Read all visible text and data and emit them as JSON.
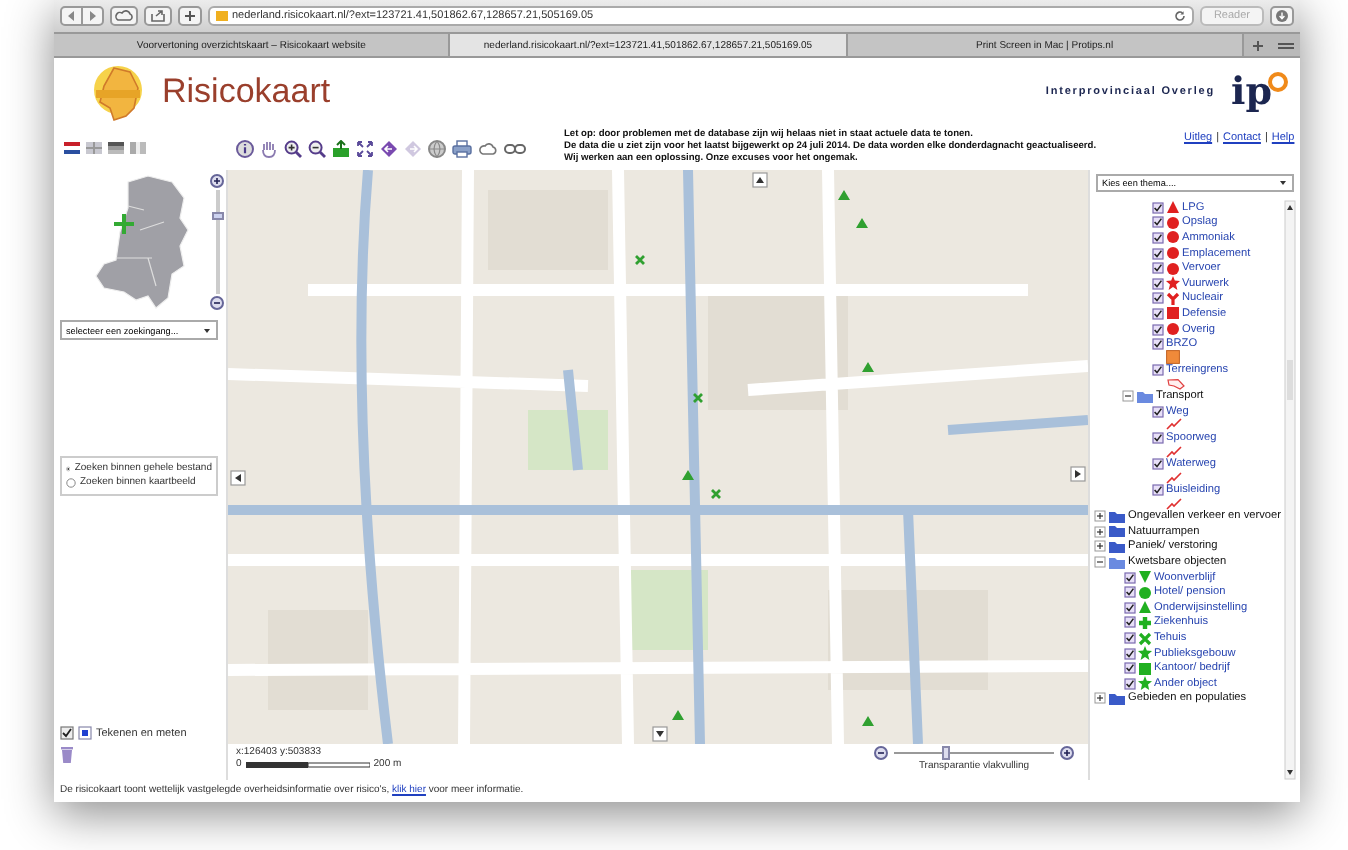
{
  "browser": {
    "address": "nederland.risicokaart.nl/?ext=123721.41,501862.67,128657.21,505169.05",
    "reader_button": "Reader",
    "tabs": [
      {
        "label": "Voorvertoning overzichtskaart – Risicokaart website",
        "selected": false
      },
      {
        "label": "nederland.risicokaart.nl/?ext=123721.41,501862.67,128657.21,505169.05",
        "selected": true
      },
      {
        "label": "Print Screen in Mac | Protips.nl",
        "selected": false
      }
    ]
  },
  "header": {
    "title": "Risicokaart",
    "partner": "Interprovinciaal Overleg",
    "partner_logo": "ip"
  },
  "notice": [
    "Let op: door problemen met de database zijn wij helaas niet in staat actuele data te tonen.",
    "De data die u ziet zijn voor het laatst bijgewerkt op 24 juli 2014. De data worden elke donderdagnacht geactualiseerd.",
    "Wij werken aan een oplossing. Onze excuses voor het ongemak."
  ],
  "links": [
    {
      "kind": "link",
      "text": "Uitleg"
    },
    {
      "kind": "separator",
      "text": "|"
    },
    {
      "kind": "link",
      "text": "Contact"
    },
    {
      "kind": "separator",
      "text": "|"
    },
    {
      "kind": "link",
      "text": "Help"
    }
  ],
  "zoom_slider": {
    "level": 0.78
  },
  "search": {
    "value": "selecteer  een zoekingang...",
    "scope_options": [
      {
        "label": "Zoeken binnen gehele bestand",
        "selected": true
      },
      {
        "label": "Zoeken binnen kaartbeeld",
        "selected": false
      }
    ]
  },
  "draw_tool": {
    "label": "Tekenen en meten",
    "checked": true
  },
  "theme_select": {
    "value": "Kies een thema...."
  },
  "layers": [
    {
      "kind": "continued",
      "children": [
        {
          "kind": "continued",
          "children": [
            {
              "kind": "triangle",
              "label": "LPG",
              "checked": true,
              "color": "#e02020"
            },
            {
              "kind": "circle",
              "label": "Opslag",
              "checked": true,
              "color": "#e02020"
            },
            {
              "kind": "circle",
              "label": "Ammoniak",
              "checked": true,
              "color": "#e02020"
            },
            {
              "kind": "circle",
              "label": "Emplacement",
              "checked": true,
              "color": "#e02020"
            },
            {
              "kind": "circle",
              "label": "Vervoer",
              "checked": true,
              "color": "#e02020"
            },
            {
              "kind": "burst",
              "label": "Vuurwerk",
              "checked": true,
              "color": "#e02020"
            },
            {
              "kind": "trefoil",
              "label": "Nucleair",
              "checked": true,
              "color": "#e02020"
            },
            {
              "kind": "square",
              "label": "Defensie",
              "checked": true,
              "color": "#e02020"
            },
            {
              "kind": "circle",
              "label": "Overig",
              "checked": true,
              "color": "#e02020"
            },
            {
              "kind": "swatch",
              "label": "BRZO",
              "checked": true
            },
            {
              "kind": "outline",
              "label": "Terreingrens",
              "checked": true
            }
          ]
        },
        {
          "kind": "folder",
          "label": "Transport",
          "expanded": true,
          "children": [
            {
              "kind": "line",
              "label": "Weg",
              "checked": true
            },
            {
              "kind": "line",
              "label": "Spoorweg",
              "checked": true
            },
            {
              "kind": "line",
              "label": "Waterweg",
              "checked": true
            },
            {
              "kind": "line",
              "label": "Buisleiding",
              "checked": true
            }
          ]
        }
      ]
    },
    {
      "kind": "folder",
      "label": "Ongevallen verkeer en vervoer",
      "expanded": false
    },
    {
      "kind": "folder",
      "label": "Natuurrampen",
      "expanded": false
    },
    {
      "kind": "folder",
      "label": "Paniek/ verstoring",
      "expanded": false
    },
    {
      "kind": "folder",
      "label": "Kwetsbare objecten",
      "expanded": true,
      "children": [
        {
          "kind": "down-triangle",
          "label": "Woonverblijf",
          "checked": true,
          "color": "#20b020"
        },
        {
          "kind": "circle",
          "label": "Hotel/ pension",
          "checked": true,
          "color": "#20b020"
        },
        {
          "kind": "triangle",
          "label": "Onderwijsinstelling",
          "checked": true,
          "color": "#20b020"
        },
        {
          "kind": "cross",
          "label": "Ziekenhuis",
          "checked": true,
          "color": "#20b020"
        },
        {
          "kind": "x",
          "label": "Tehuis",
          "checked": true,
          "color": "#20b020"
        },
        {
          "kind": "burst",
          "label": "Publieksgebouw",
          "checked": true,
          "color": "#20b020"
        },
        {
          "kind": "square",
          "label": "Kantoor/ bedrijf",
          "checked": true,
          "color": "#20b020"
        },
        {
          "kind": "star",
          "label": "Ander object",
          "checked": true,
          "color": "#20b020"
        }
      ]
    },
    {
      "kind": "folder",
      "label": "Gebieden en populaties",
      "expanded": false
    }
  ],
  "map_status": {
    "coordinates": "x:126403 y:503833",
    "scale_start": "0",
    "scale_end": "200 m"
  },
  "transparency": {
    "label": "Transparantie vlakvulling",
    "level": 0.3
  },
  "footer": {
    "text_before": "De risicokaart toont wettelijk vastgelegde overheidsinformatie over risico's, ",
    "link": "klik hier",
    "text_after": " voor meer informatie."
  }
}
